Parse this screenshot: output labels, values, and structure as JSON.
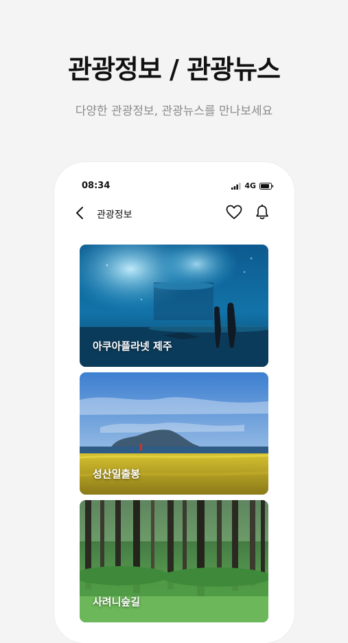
{
  "headline": "관광정보 / 관광뉴스",
  "subline": "다양한 관광정보, 관광뉴스를 만나보세요",
  "status": {
    "time": "08:34",
    "network": "4G"
  },
  "nav": {
    "title": "관광정보",
    "back_icon": "chevron-left-icon",
    "favorite_icon": "heart-icon",
    "notification_icon": "bell-icon"
  },
  "cards": [
    {
      "label": "아쿠아플라넷 제주"
    },
    {
      "label": "성산일출봉"
    },
    {
      "label": "사려니숲길"
    }
  ],
  "colors": {
    "background": "#f4f4f5",
    "phone": "#ffffff",
    "headline": "#111111",
    "subline": "#8a8a8a"
  }
}
